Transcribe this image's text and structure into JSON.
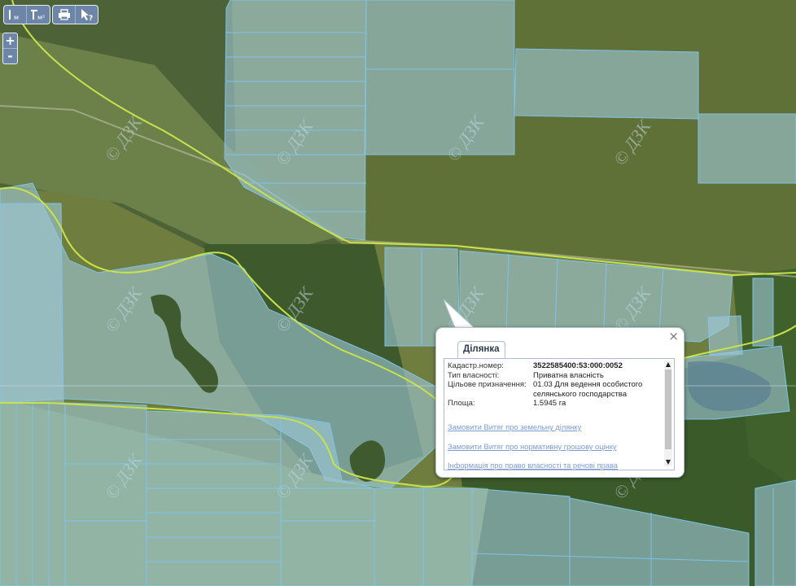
{
  "toolbar": {
    "measure_length": "м",
    "measure_area": "м²",
    "print_icon": "printer-icon",
    "identify_icon": "cursor-question-icon",
    "identify_label": "?"
  },
  "zoom": {
    "in_label": "+",
    "out_label": "-"
  },
  "watermark": "© ДЗК",
  "popup": {
    "tab_label": "Ділянка",
    "close_label": "×",
    "fields": [
      {
        "key": "Кадастр.номер:",
        "value": "3522585400:53:000:0052",
        "bold": true
      },
      {
        "key": "Тип власності:",
        "value": "Приватна власність"
      },
      {
        "key": "Цільове призначення:",
        "value": "01.03 Для ведення особистого селянського господарства"
      },
      {
        "key": "Площа:",
        "value": "1.5945 га"
      }
    ],
    "links": [
      "Замовити Витяг про земельну ділянку",
      "Замовити Витяг про нормативну грошову оцінку",
      "Інформація про право власності та речові права"
    ],
    "scroll_up": "▲",
    "scroll_down": "▼"
  },
  "colors": {
    "field_dark": "#5f7136",
    "forest": "#3f5a2e",
    "meadow": "#7f9451",
    "parcel_fill": "#9cc6d6",
    "parcel_stroke": "#7ec3ea",
    "boundary": "#c8e34a",
    "toolbar": "#6d86a8",
    "link": "#7b9bd4"
  }
}
